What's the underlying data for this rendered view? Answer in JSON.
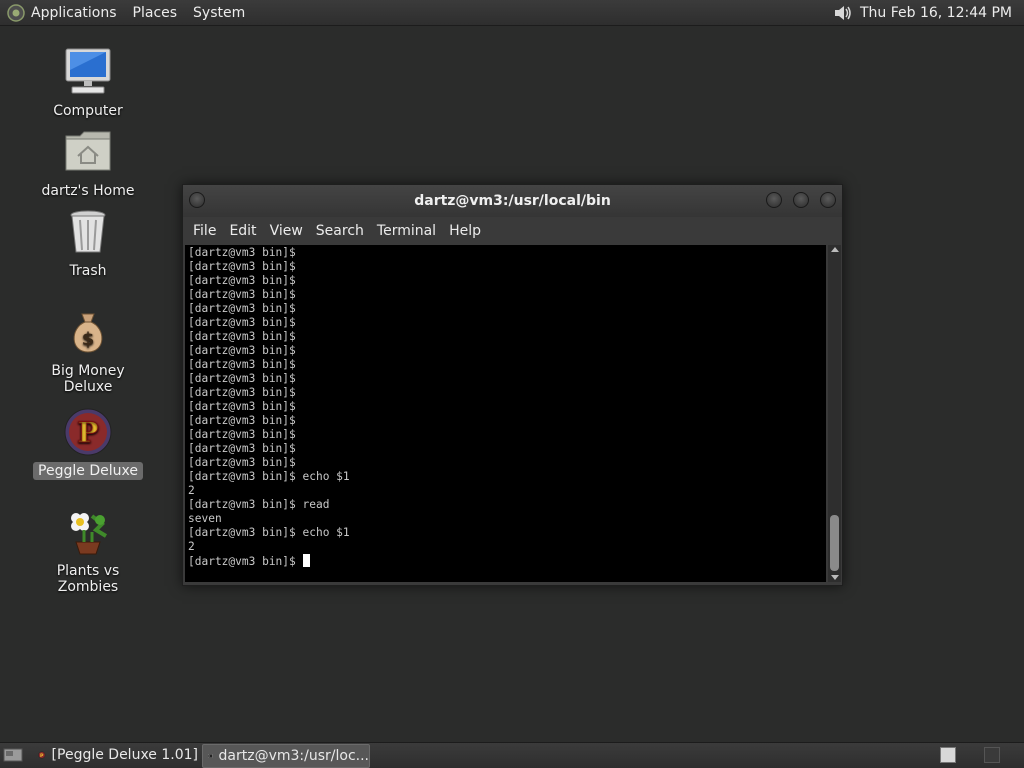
{
  "top_panel": {
    "menus": [
      "Applications",
      "Places",
      "System"
    ],
    "clock": "Thu Feb 16, 12:44 PM",
    "volume_icon": "speaker-icon"
  },
  "desktop": {
    "icons": [
      {
        "label": "Computer",
        "icon": "computer-icon"
      },
      {
        "label": "dartz's Home",
        "icon": "home-folder-icon"
      },
      {
        "label": "Trash",
        "icon": "trash-icon"
      },
      {
        "label": "Big Money Deluxe",
        "icon": "money-bag-icon"
      },
      {
        "label": "Peggle Deluxe",
        "icon": "peggle-icon",
        "selected": true
      },
      {
        "label": "Plants vs Zombies",
        "icon": "flower-pot-icon"
      }
    ]
  },
  "terminal": {
    "title": "dartz@vm3:/usr/local/bin",
    "menu": [
      "File",
      "Edit",
      "View",
      "Search",
      "Terminal",
      "Help"
    ],
    "lines": [
      "[dartz@vm3 bin]$",
      "[dartz@vm3 bin]$",
      "[dartz@vm3 bin]$",
      "[dartz@vm3 bin]$",
      "[dartz@vm3 bin]$",
      "[dartz@vm3 bin]$",
      "[dartz@vm3 bin]$",
      "[dartz@vm3 bin]$",
      "[dartz@vm3 bin]$",
      "[dartz@vm3 bin]$",
      "[dartz@vm3 bin]$",
      "[dartz@vm3 bin]$",
      "[dartz@vm3 bin]$",
      "[dartz@vm3 bin]$",
      "[dartz@vm3 bin]$",
      "[dartz@vm3 bin]$",
      "[dartz@vm3 bin]$ echo $1",
      "2",
      "[dartz@vm3 bin]$ read",
      "seven",
      "[dartz@vm3 bin]$ echo $1",
      "2"
    ],
    "prompt": "[dartz@vm3 bin]$ "
  },
  "bottom_panel": {
    "tasks": [
      {
        "label": "[Peggle Deluxe 1.01]",
        "icon": "peggle-icon",
        "active": false
      },
      {
        "label": "dartz@vm3:/usr/loc...",
        "icon": "terminal-icon",
        "active": true
      }
    ],
    "show_desktop_icon": "show-desktop-icon"
  }
}
